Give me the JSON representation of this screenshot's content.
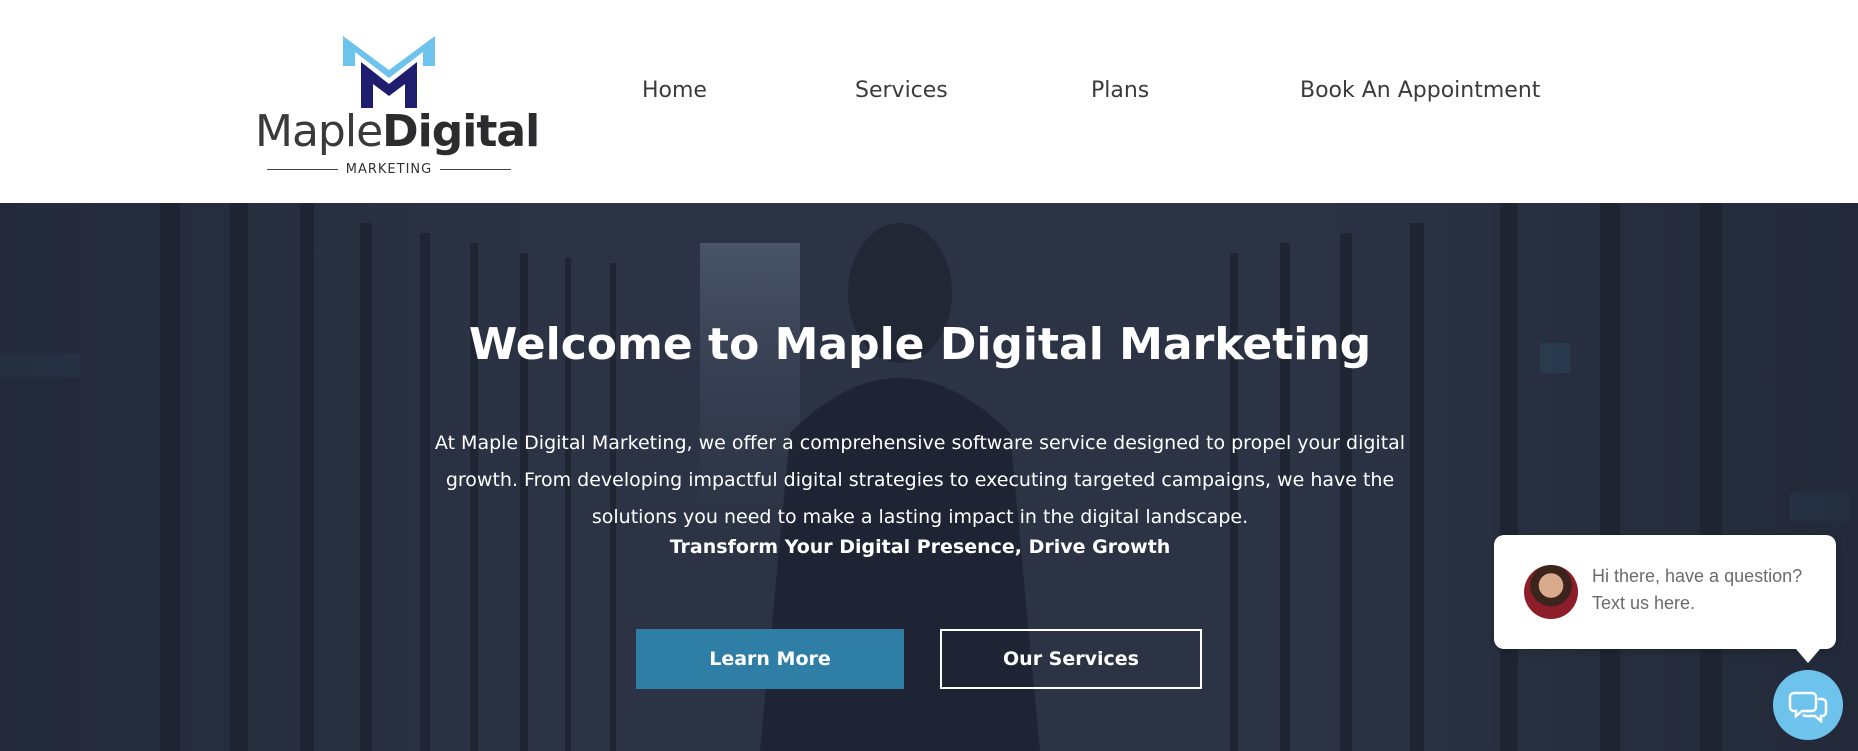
{
  "brand": {
    "name_regular": "Maple",
    "name_bold": "Digital",
    "tagline": "MARKETING",
    "colors": {
      "light_blue": "#6ec3ec",
      "navy": "#1f1d6e"
    }
  },
  "nav": {
    "items": [
      {
        "label": "Home"
      },
      {
        "label": "Services"
      },
      {
        "label": "Plans"
      },
      {
        "label": "Book An Appointment"
      }
    ]
  },
  "hero": {
    "title": "Welcome to Maple Digital Marketing",
    "description": "At Maple Digital Marketing, we offer a comprehensive software service designed to propel your digital growth. From developing impactful digital strategies to executing targeted campaigns, we have the solutions you need to make a lasting impact in the digital landscape.",
    "tagline": "Transform Your Digital Presence, Drive Growth",
    "buttons": {
      "learn_more": "Learn More",
      "our_services": "Our Services"
    },
    "colors": {
      "primary_button": "#2e7ea6"
    }
  },
  "chat": {
    "message": "Hi there, have a question? Text us here.",
    "launcher_icon": "chat-bubbles-icon",
    "colors": {
      "launcher": "#6ec3ec"
    }
  }
}
